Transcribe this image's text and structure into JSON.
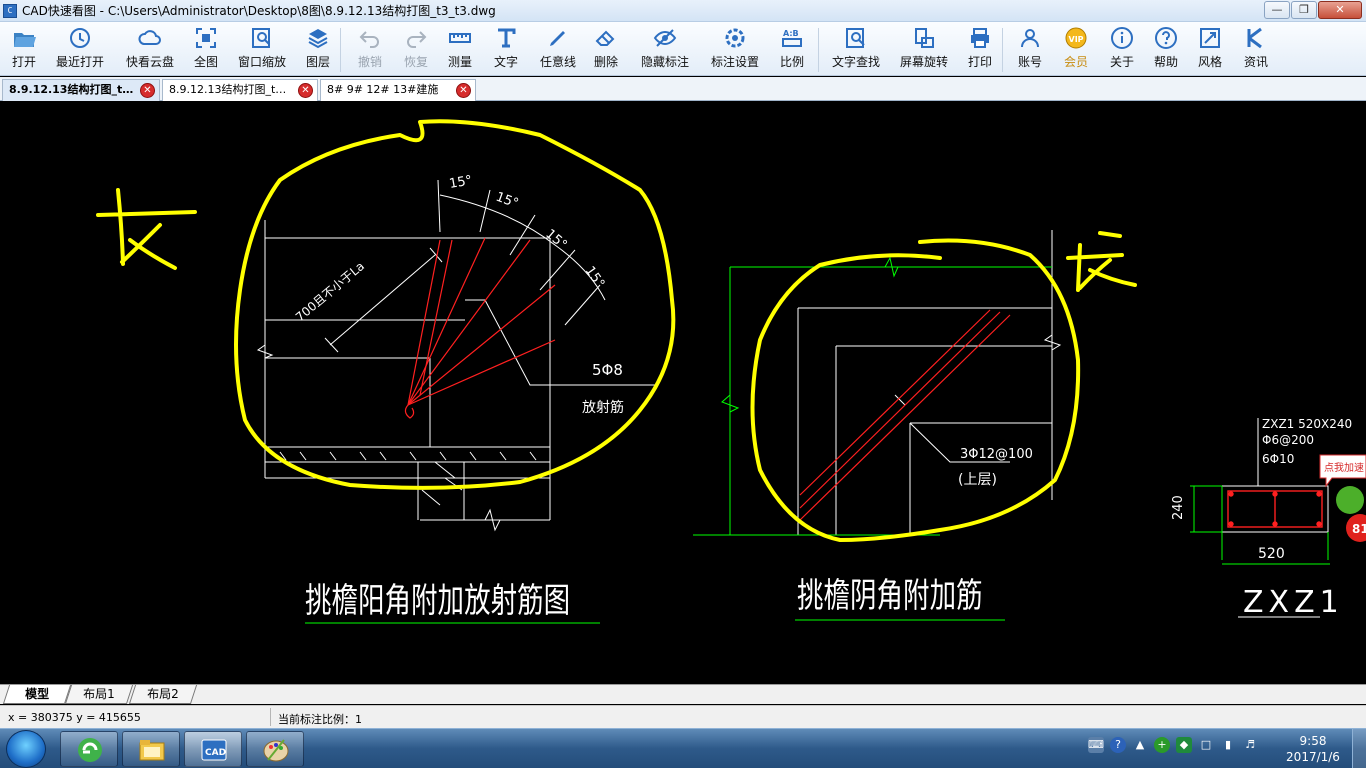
{
  "window": {
    "app_title": "CAD快速看图",
    "file_path": "C:\\Users\\Administrator\\Desktop\\8图\\8.9.12.13结构打图_t3_t3.dwg",
    "title_separator": " - "
  },
  "toolbar": {
    "items": [
      {
        "label": "打开",
        "icon": "folder-open-icon"
      },
      {
        "label": "最近打开",
        "icon": "history-icon"
      },
      {
        "label": "快看云盘",
        "icon": "cloud-icon"
      },
      {
        "label": "全图",
        "icon": "fit-all-icon"
      },
      {
        "label": "窗口缩放",
        "icon": "zoom-window-icon"
      },
      {
        "label": "图层",
        "icon": "layers-icon"
      },
      {
        "label": "撤销",
        "icon": "undo-icon",
        "disabled": true
      },
      {
        "label": "恢复",
        "icon": "redo-icon",
        "disabled": true
      },
      {
        "label": "测量",
        "icon": "ruler-icon"
      },
      {
        "label": "文字",
        "icon": "text-icon"
      },
      {
        "label": "任意线",
        "icon": "pen-icon"
      },
      {
        "label": "删除",
        "icon": "eraser-icon"
      },
      {
        "label": "隐藏标注",
        "icon": "eye-hide-icon"
      },
      {
        "label": "标注设置",
        "icon": "annotation-settings-icon"
      },
      {
        "label": "比例",
        "icon": "scale-icon"
      },
      {
        "label": "文字查找",
        "icon": "text-search-icon"
      },
      {
        "label": "屏幕旋转",
        "icon": "rotate-screen-icon"
      },
      {
        "label": "打印",
        "icon": "printer-icon"
      },
      {
        "label": "账号",
        "icon": "user-icon"
      },
      {
        "label": "会员",
        "icon": "vip-icon",
        "vip": true
      },
      {
        "label": "关于",
        "icon": "info-icon"
      },
      {
        "label": "帮助",
        "icon": "help-icon"
      },
      {
        "label": "风格",
        "icon": "style-icon"
      },
      {
        "label": "资讯",
        "icon": "news-icon"
      }
    ]
  },
  "tabs": [
    {
      "label": "8.9.12.13结构打图_t…",
      "active": true
    },
    {
      "label": "8.9.12.13结构打图_t…",
      "active": false
    },
    {
      "label": "8# 9# 12# 13#建施",
      "active": false
    }
  ],
  "drawing": {
    "left_title": "挑檐阳角附加放射筋图",
    "right_title": "挑檐阴角附加筋",
    "column_title": "ZXZ1",
    "angle_labels": [
      "15°",
      "15°",
      "15°",
      "15°"
    ],
    "length_label": "700且不小于La",
    "rebar_count": "5Φ8",
    "rebar_name": "放射筋",
    "rebar_spec": "3Φ12@100",
    "rebar_layer": "(上层)",
    "column_spec_1": "ZXZ1 520X240",
    "column_spec_2": "Φ6@200",
    "column_spec_3": "6Φ10",
    "dim_height": "240",
    "dim_width": "520",
    "annotation_left": "长",
    "annotation_right": "长",
    "speed_badge": "点我加速",
    "speed_value": "81"
  },
  "layout_tabs": [
    {
      "label": "模型",
      "active": true
    },
    {
      "label": "布局1",
      "active": false
    },
    {
      "label": "布局2",
      "active": false
    }
  ],
  "status": {
    "coordinates": "x = 380375  y = 415655",
    "scale_text": "当前标注比例：1"
  },
  "taskbar": {
    "time": "9:58",
    "date": "2017/1/6",
    "apps": [
      "start-menu",
      "file-explorer",
      "cad-viewer",
      "paint"
    ]
  },
  "colors": {
    "canvas_bg": "#000000",
    "drawing_white": "#ffffff",
    "markup_yellow": "#ffff00",
    "rebar_red": "#ff2020",
    "dim_green": "#00ff00",
    "close_red": "#d62c2c",
    "vip_gold": "#c88d12"
  }
}
